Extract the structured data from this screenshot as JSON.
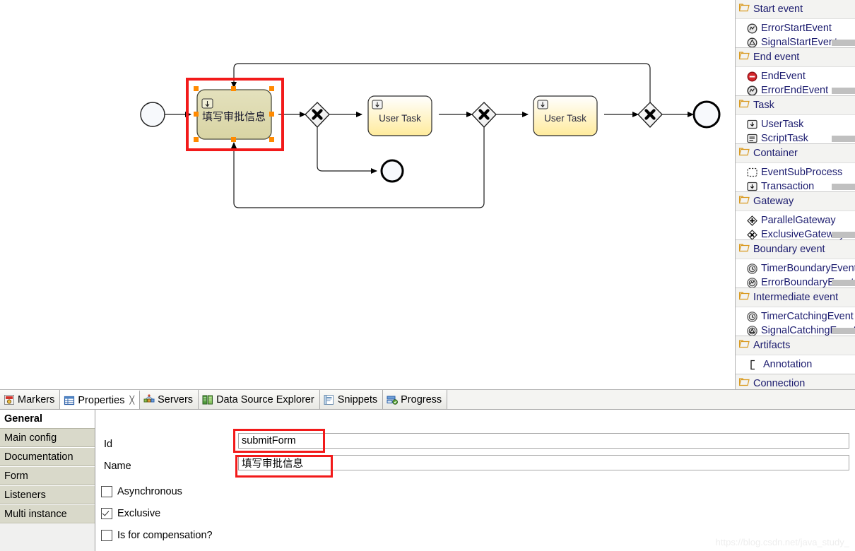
{
  "canvas": {
    "nodes": [
      {
        "id": "startEvent",
        "type": "start-event",
        "label": ""
      },
      {
        "id": "submitForm",
        "type": "user-task",
        "label": "填写审批信息",
        "selected": true
      },
      {
        "id": "gw1",
        "type": "exclusive-gateway",
        "label": ""
      },
      {
        "id": "userTask1",
        "type": "user-task",
        "label": "User Task"
      },
      {
        "id": "gw2",
        "type": "exclusive-gateway",
        "label": ""
      },
      {
        "id": "userTask2",
        "type": "user-task",
        "label": "User Task"
      },
      {
        "id": "gw3",
        "type": "exclusive-gateway",
        "label": ""
      },
      {
        "id": "endEvent1",
        "type": "end-event",
        "label": ""
      },
      {
        "id": "endEvent2",
        "type": "end-event",
        "label": ""
      }
    ],
    "colors": {
      "selected_task_fill": "#dedbb0",
      "task_fill_top": "#ffffff",
      "task_fill_bottom": "#ffefa8",
      "selection_handle": "#ff8a00",
      "highlight": "#f21a1a",
      "event_fill": "#f7f9fc"
    }
  },
  "palette": {
    "sections": [
      {
        "title": "Start event",
        "items": [
          {
            "label": "ErrorStartEvent",
            "icon": "error-start-event-icon"
          },
          {
            "label": "SignalStartEvent",
            "icon": "signal-start-event-icon"
          }
        ]
      },
      {
        "title": "End event",
        "items": [
          {
            "label": "EndEvent",
            "icon": "end-event-icon"
          },
          {
            "label": "ErrorEndEvent",
            "icon": "error-end-event-icon"
          }
        ]
      },
      {
        "title": "Task",
        "items": [
          {
            "label": "UserTask",
            "icon": "user-task-icon"
          },
          {
            "label": "ScriptTask",
            "icon": "script-task-icon"
          }
        ]
      },
      {
        "title": "Container",
        "items": [
          {
            "label": "EventSubProcess",
            "icon": "event-sub-process-icon"
          },
          {
            "label": "Transaction",
            "icon": "transaction-icon"
          }
        ]
      },
      {
        "title": "Gateway",
        "items": [
          {
            "label": "ParallelGateway",
            "icon": "parallel-gateway-icon"
          },
          {
            "label": "ExclusiveGateway",
            "icon": "exclusive-gateway-icon"
          }
        ]
      },
      {
        "title": "Boundary event",
        "items": [
          {
            "label": "TimerBoundaryEvent",
            "icon": "timer-boundary-event-icon"
          },
          {
            "label": "ErrorBoundaryEvent",
            "icon": "error-boundary-event-icon"
          }
        ]
      },
      {
        "title": "Intermediate event",
        "items": [
          {
            "label": "TimerCatchingEvent",
            "icon": "timer-catching-event-icon"
          },
          {
            "label": "SignalCatchingEvent",
            "icon": "signal-catching-event-icon"
          }
        ]
      },
      {
        "title": "Artifacts",
        "items": [
          {
            "label": "Annotation",
            "icon": "annotation-icon"
          }
        ]
      },
      {
        "title": "Connection",
        "items": []
      }
    ]
  },
  "bottom": {
    "tabs": [
      {
        "label": "Markers",
        "icon": "markers-icon",
        "active": false,
        "closable": false
      },
      {
        "label": "Properties",
        "icon": "properties-icon",
        "active": true,
        "closable": true
      },
      {
        "label": "Servers",
        "icon": "servers-icon",
        "active": false,
        "closable": false
      },
      {
        "label": "Data Source Explorer",
        "icon": "data-source-explorer-icon",
        "active": false,
        "closable": false
      },
      {
        "label": "Snippets",
        "icon": "snippets-icon",
        "active": false,
        "closable": false
      },
      {
        "label": "Progress",
        "icon": "progress-icon",
        "active": false,
        "closable": false
      }
    ],
    "property_tabs": [
      {
        "label": "General",
        "selected": true
      },
      {
        "label": "Main config",
        "selected": false
      },
      {
        "label": "Documentation",
        "selected": false
      },
      {
        "label": "Form",
        "selected": false
      },
      {
        "label": "Listeners",
        "selected": false
      },
      {
        "label": "Multi instance",
        "selected": false
      }
    ],
    "form": {
      "id_label": "Id",
      "id_value": "submitForm",
      "id_placeholder": "",
      "name_label": "Name",
      "name_value": "填写审批信息",
      "name_placeholder": "",
      "checkboxes": [
        {
          "label": "Asynchronous",
          "checked": false
        },
        {
          "label": "Exclusive",
          "checked": true
        },
        {
          "label": "Is for compensation?",
          "checked": false
        }
      ]
    }
  },
  "watermark": "https://blog.csdn.net/java_study_"
}
